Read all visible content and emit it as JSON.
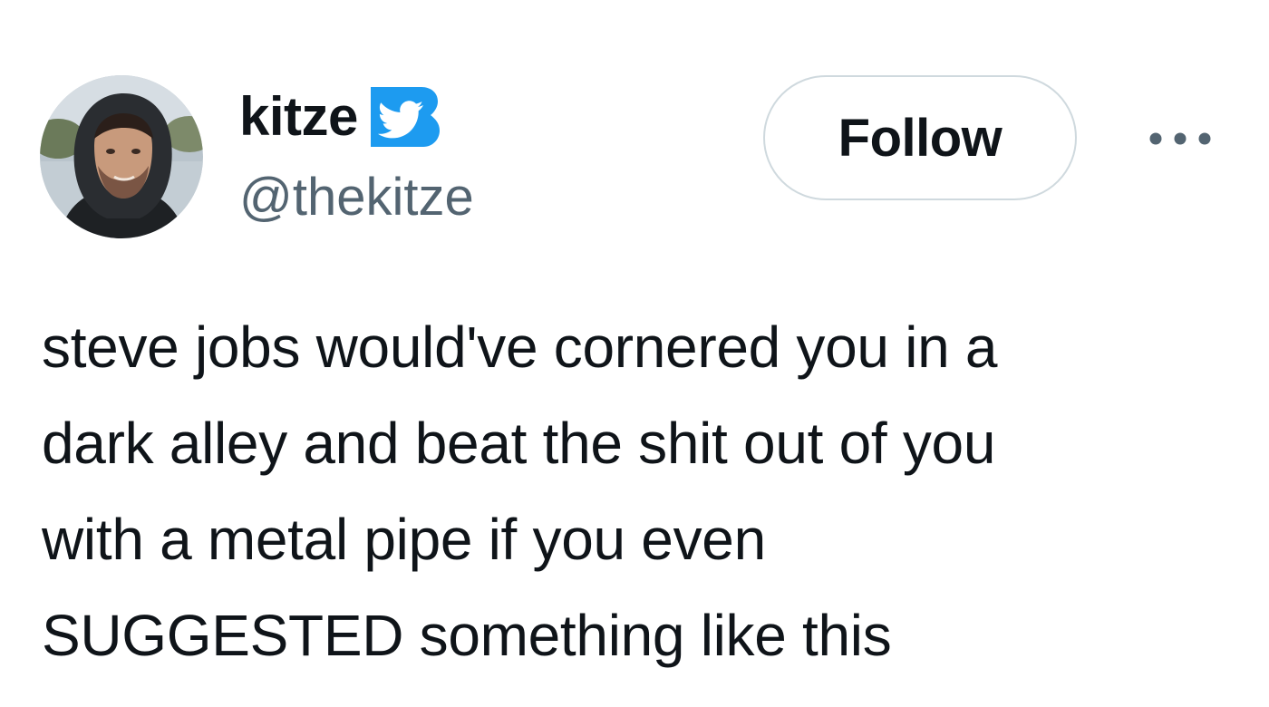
{
  "author": {
    "display_name": "kitze",
    "handle": "@thekitze",
    "verified": true,
    "avatar_icon": "avatar-photo"
  },
  "actions": {
    "follow_label": "Follow",
    "more_icon": "more-horizontal-icon"
  },
  "tweet": {
    "text": "steve jobs would've cornered you in a\ndark alley and beat the shit out of you\nwith a metal pipe if you even\nSUGGESTED something like this"
  },
  "colors": {
    "text_primary": "#0f1419",
    "text_secondary": "#536471",
    "verified_blue": "#1d9bf0",
    "button_border": "#cfd9de"
  }
}
